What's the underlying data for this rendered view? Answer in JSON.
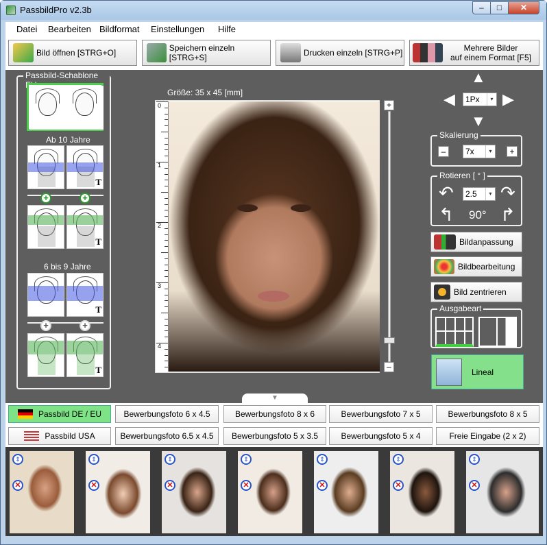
{
  "window": {
    "title": "PassbildPro  v2.3b",
    "min_label": "–",
    "max_label": "□",
    "close_label": "✕"
  },
  "menu": {
    "items": [
      "Datei",
      "Bearbeiten",
      "Bildformat",
      "Einstellungen",
      "Hilfe"
    ]
  },
  "toolbar": {
    "open_label": "Bild öffnen [STRG+O]",
    "save_label": "Speichern einzeln [STRG+S]",
    "print_label": "Drucken einzeln [STRG+P]",
    "multi_label_1": "Mehrere Bilder",
    "multi_label_2": "auf einem Format [F5]"
  },
  "template_group": {
    "title": "Passbild-Schablone EU",
    "age_10_label": "Ab 10 Jahre",
    "age_6_9_label": "6 bis 9 Jahre",
    "letter": "T"
  },
  "photo": {
    "size_label": "Größe: 35 x 45 [mm]",
    "ruler_numbers": [
      "0",
      "1",
      "2",
      "3",
      "4"
    ]
  },
  "position": {
    "step_value": "1Px",
    "step_arrow": "▾"
  },
  "scaling": {
    "title": "Skalierung",
    "minus": "–",
    "plus": "+",
    "value": "7x"
  },
  "rotate": {
    "title": "Rotieren [ ° ]",
    "value": "2.5",
    "angle_90": "90°"
  },
  "side_buttons": {
    "adjust_label": "Bildanpassung",
    "edit_label": "Bildbearbeitung",
    "center_label": "Bild zentrieren"
  },
  "output": {
    "title": "Ausgabeart"
  },
  "lineal": {
    "label": "Lineal"
  },
  "format_buttons": {
    "row1": [
      "Passbild DE / EU",
      "Bewerbungsfoto 6 x 4.5",
      "Bewerbungsfoto 8 x 6",
      "Bewerbungsfoto 7 x 5",
      "Bewerbungsfoto 8 x 5"
    ],
    "row2": [
      "Passbild USA",
      "Bewerbungsfoto 6.5 x 4.5",
      "Bewerbungsfoto 5 x 3.5",
      "Bewerbungsfoto 5 x 4",
      "Freie Eingabe (2 x 2)"
    ]
  },
  "thumbnails": {
    "count": 7,
    "up_icon": "⇕",
    "delete_icon": "✕"
  },
  "colors": {
    "accent_green": "#7ee386",
    "panel_gray": "#5e5e5e",
    "window_blue": "#bdd3ea"
  }
}
